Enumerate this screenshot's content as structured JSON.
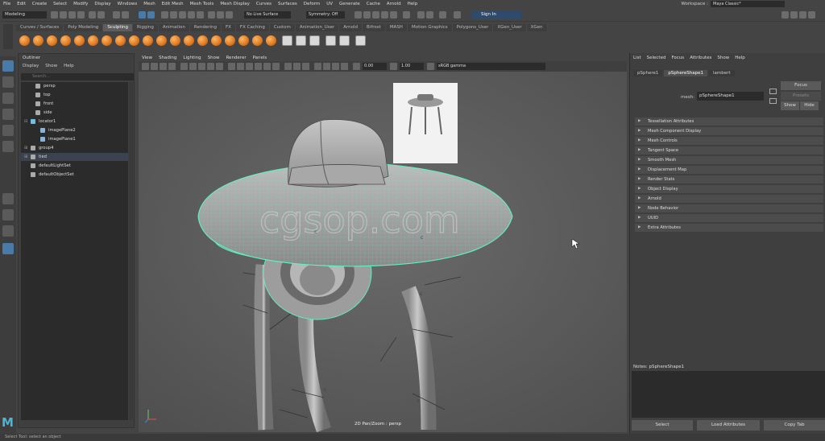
{
  "menubar": [
    "File",
    "Edit",
    "Create",
    "Select",
    "Modify",
    "Display",
    "Windows",
    "Mesh",
    "Edit Mesh",
    "Mesh Tools",
    "Mesh Display",
    "Curves",
    "Surfaces",
    "Deform",
    "UV",
    "Generate",
    "Cache",
    "Arnold",
    "Help"
  ],
  "workspace": {
    "label": "Workspace :",
    "value": "Maya Classic*"
  },
  "status": {
    "mode": "Modeling",
    "live_surface": "No Live Surface",
    "symmetry": "Symmetry: Off",
    "sign_in": "Sign In"
  },
  "shelf_tabs": [
    "Curves / Surfaces",
    "Poly Modeling",
    "Sculpting",
    "Rigging",
    "Animation",
    "Rendering",
    "FX",
    "FX Caching",
    "Custom",
    "Animation_User",
    "Arnold",
    "Bifrost",
    "MASH",
    "Motion Graphics",
    "Polygons_User",
    "XGen_User",
    "XGen"
  ],
  "shelf_active": "Sculpting",
  "outliner": {
    "title": "Outliner",
    "menu": [
      "Display",
      "Show",
      "Help"
    ],
    "search_placeholder": "Search...",
    "items": [
      {
        "label": "persp"
      },
      {
        "label": "top"
      },
      {
        "label": "front"
      },
      {
        "label": "side"
      },
      {
        "label": "locator1"
      },
      {
        "label": "imagePlane2"
      },
      {
        "label": "imagePlane1"
      },
      {
        "label": "group4"
      },
      {
        "label": "tied"
      },
      {
        "label": "defaultLightSet"
      },
      {
        "label": "defaultObjectSet"
      }
    ]
  },
  "viewport": {
    "menu": [
      "View",
      "Shading",
      "Lighting",
      "Show",
      "Renderer",
      "Panels"
    ],
    "field1": "0.00",
    "field2": "1.00",
    "colorspace": "sRGB gamma",
    "camera_label": "2D Pan/Zoom : persp",
    "watermark": "cgsop.com"
  },
  "attribute_editor": {
    "menu": [
      "List",
      "Selected",
      "Focus",
      "Attributes",
      "Show",
      "Help"
    ],
    "tabs": [
      "pSphere1",
      "pSphereShape1",
      "lambert"
    ],
    "mesh_label": "mesh:",
    "mesh_value": "pSphereShape1",
    "focus": "Focus",
    "presets": "Presets",
    "show": "Show",
    "hide": "Hide",
    "sections": [
      "Tessellation Attributes",
      "Mesh Component Display",
      "Mesh Controls",
      "Tangent Space",
      "Smooth Mesh",
      "Displacement Map",
      "Render Stats",
      "Object Display",
      "Arnold",
      "Node Behavior",
      "UUID",
      "Extra Attributes"
    ],
    "notes": "Notes: pSphereShape1",
    "buttons": [
      "Select",
      "Load Attributes",
      "Copy Tab"
    ]
  },
  "helpline": "Select Tool: select an object",
  "colors": {
    "accent": "#4a7aa8",
    "wire": "#55f0b0",
    "logo": "#4ab6d6"
  }
}
